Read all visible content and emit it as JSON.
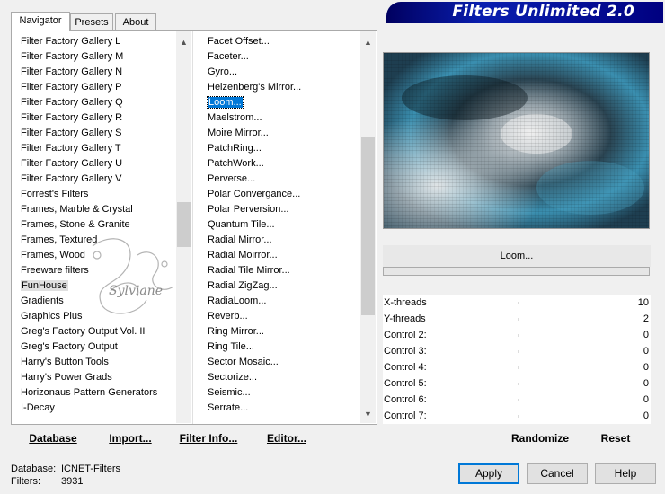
{
  "tabs": [
    {
      "label": "Navigator",
      "active": true
    },
    {
      "label": "Presets",
      "active": false
    },
    {
      "label": "About",
      "active": false
    }
  ],
  "banner_title": "Filters Unlimited 2.0",
  "categories": {
    "items": [
      "Filter Factory Gallery L",
      "Filter Factory Gallery M",
      "Filter Factory Gallery N",
      "Filter Factory Gallery P",
      "Filter Factory Gallery Q",
      "Filter Factory Gallery R",
      "Filter Factory Gallery S",
      "Filter Factory Gallery T",
      "Filter Factory Gallery U",
      "Filter Factory Gallery V",
      "Forrest's Filters",
      "Frames, Marble & Crystal",
      "Frames, Stone & Granite",
      "Frames, Textured",
      "Frames, Wood",
      "Freeware filters",
      "FunHouse",
      "Gradients",
      "Graphics Plus",
      "Greg's Factory Output Vol. II",
      "Greg's Factory Output",
      "Harry's Button Tools",
      "Harry's Power Grads",
      "Horizonaus Pattern Generators",
      "I-Decay"
    ],
    "selected": "FunHouse"
  },
  "filters": {
    "items": [
      "Facet Offset...",
      "Faceter...",
      "Gyro...",
      "Heizenberg's Mirror...",
      "Loom...",
      "Maelstrom...",
      "Moire Mirror...",
      "PatchRing...",
      "PatchWork...",
      "Perverse...",
      "Polar Convergance...",
      "Polar Perversion...",
      "Quantum Tile...",
      "Radial Mirror...",
      "Radial Moirror...",
      "Radial Tile Mirror...",
      "Radial ZigZag...",
      "RadiaLoom...",
      "Reverb...",
      "Ring Mirror...",
      "Ring Tile...",
      "Sector Mosaic...",
      "Sectorize...",
      "Seismic...",
      "Serrate..."
    ],
    "selected": "Loom..."
  },
  "watermark_text": "Sylviane",
  "current_filter": "Loom...",
  "progress": 0,
  "params": [
    {
      "name": "X-threads",
      "value": "10"
    },
    {
      "name": "Y-threads",
      "value": "2"
    },
    {
      "name": "Control 2:",
      "value": "0"
    },
    {
      "name": "Control 3:",
      "value": "0"
    },
    {
      "name": "Control 4:",
      "value": "0"
    },
    {
      "name": "Control 5:",
      "value": "0"
    },
    {
      "name": "Control 6:",
      "value": "0"
    },
    {
      "name": "Control 7:",
      "value": "0"
    }
  ],
  "left_buttons": {
    "database": "Database",
    "import": "Import...",
    "filter_info": "Filter Info...",
    "editor": "Editor..."
  },
  "right_buttons": {
    "randomize": "Randomize",
    "reset": "Reset"
  },
  "status": {
    "database_label": "Database:",
    "database_value": "ICNET-Filters",
    "filters_label": "Filters:",
    "filters_value": "3931"
  },
  "dialog_buttons": {
    "apply": "Apply",
    "cancel": "Cancel",
    "help": "Help"
  },
  "colors": {
    "selection": "#0078d7",
    "banner": "#0a1fb0",
    "preview_accent": "#3a8fb0"
  }
}
